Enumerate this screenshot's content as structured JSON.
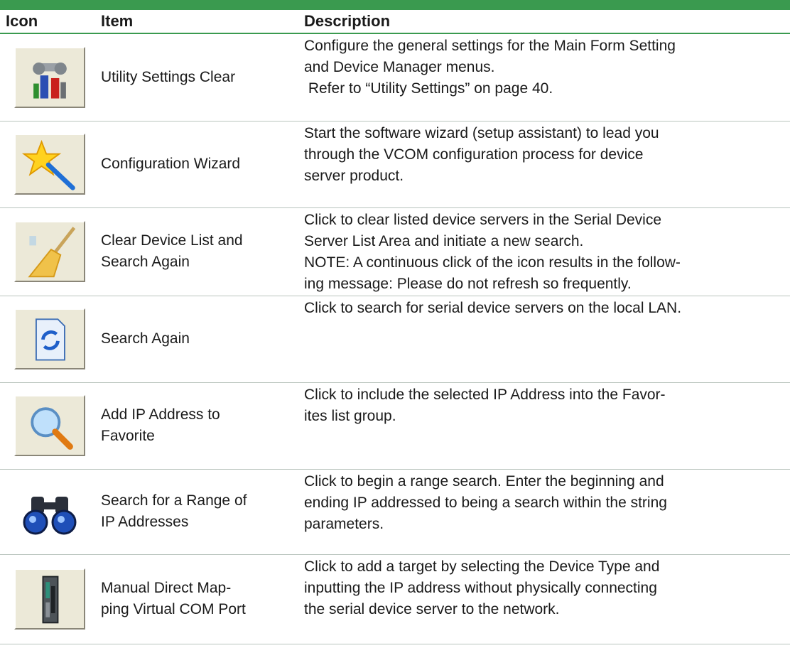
{
  "header": {
    "icon": "Icon",
    "item": "Item",
    "description": "Description"
  },
  "rows": [
    {
      "icon": "utility-settings-icon",
      "item": [
        "Utility Settings Clear"
      ],
      "desc": [
        "Configure the general settings for the Main Form Setting",
        "and Device Manager menus.",
        " Refer to “Utility Settings” on page 40."
      ]
    },
    {
      "icon": "wizard-star-icon",
      "item": [
        "Configuration Wizard"
      ],
      "desc": [
        "Start the software wizard (setup assistant) to lead you",
        "through the VCOM configuration process for device",
        "server product."
      ]
    },
    {
      "icon": "broom-icon",
      "item": [
        "Clear Device List and",
        "Search Again"
      ],
      "desc": [
        "Click to clear listed device servers in the Serial Device",
        "Server List Area and initiate a new search.",
        "NOTE: A continuous click of the icon results in the follow-",
        "ing message: Please do not refresh so frequently."
      ]
    },
    {
      "icon": "refresh-document-icon",
      "item": [
        "Search Again"
      ],
      "desc": [
        "Click to search for serial device servers on the local LAN."
      ]
    },
    {
      "icon": "magnifier-icon",
      "item": [
        "Add IP Address to",
        "Favorite"
      ],
      "desc": [
        "Click to include the selected IP Address into the Favor-",
        "ites list group."
      ]
    },
    {
      "icon": "binoculars-icon",
      "item": [
        "Search for a Range of",
        "IP Addresses"
      ],
      "desc": [
        "Click to begin a range search. Enter the beginning and",
        "ending IP addressed to being a search within the string",
        "parameters."
      ]
    },
    {
      "icon": "device-server-icon",
      "item": [
        "Manual Direct Map-",
        "ping Virtual COM Port"
      ],
      "desc": [
        "Click to add a target by selecting the Device Type and",
        "inputting the IP address without physically connecting",
        "the serial device server to the network."
      ]
    }
  ]
}
